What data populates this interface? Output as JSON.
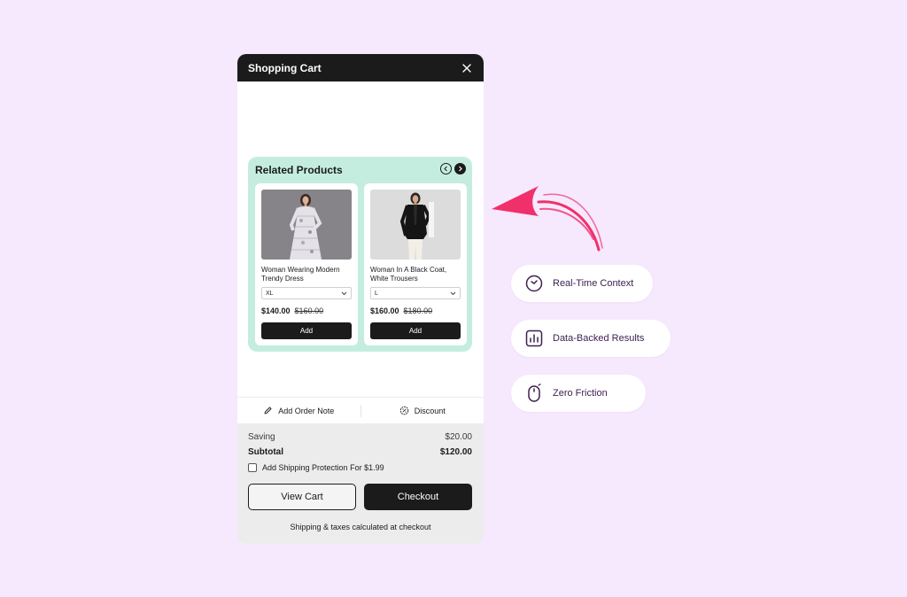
{
  "cart": {
    "title": "Shopping Cart",
    "related": {
      "title": "Related Products",
      "products": [
        {
          "name": "Woman Wearing Modern Trendy Dress",
          "size": "XL",
          "price": "$140.00",
          "original_price": "$160.00",
          "add_label": "Add"
        },
        {
          "name": "Woman In A Black Coat, White Trousers",
          "size": "L",
          "price": "$160.00",
          "original_price": "$180.00",
          "add_label": "Add"
        }
      ]
    },
    "actions": {
      "order_note": "Add Order Note",
      "discount": "Discount"
    },
    "summary": {
      "saving_label": "Saving",
      "saving_value": "$20.00",
      "subtotal_label": "Subtotal",
      "subtotal_value": "$120.00",
      "shipping_protection": "Add Shipping Protection For $1.99",
      "view_cart": "View Cart",
      "checkout": "Checkout",
      "note": "Shipping & taxes calculated at checkout"
    }
  },
  "features": [
    {
      "label": "Real-Time Context",
      "icon": "clock-icon"
    },
    {
      "label": "Data-Backed Results",
      "icon": "bar-chart-icon"
    },
    {
      "label": "Zero Friction",
      "icon": "mouse-icon"
    }
  ],
  "colors": {
    "background": "#f6e8fd",
    "header": "#1b1b1b",
    "related_bg": "#c4ede0",
    "arrow": "#f0306b",
    "pill_text": "#3e2150"
  }
}
